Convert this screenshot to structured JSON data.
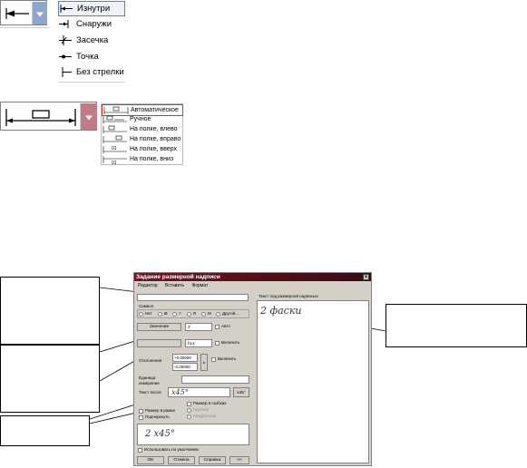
{
  "arrow_combo": {
    "icon": "arrow-inside-icon"
  },
  "arrow_list": {
    "items": [
      {
        "label": "Изнутри",
        "icon": "arrow-inside-icon",
        "selected": true
      },
      {
        "label": "Снаружи",
        "icon": "arrow-outside-icon"
      },
      {
        "label": "Засечка",
        "icon": "tick-mark-icon"
      },
      {
        "label": "Точка",
        "icon": "dot-icon"
      },
      {
        "label": "Без стрелки",
        "icon": "no-arrow-icon"
      }
    ]
  },
  "placement_list": {
    "items": [
      {
        "label": "Автоматическое",
        "selected": true
      },
      {
        "label": "Ручное"
      },
      {
        "label": "На полке, влево"
      },
      {
        "label": "На полке, вправо"
      },
      {
        "label": "На полке, вверх"
      },
      {
        "label": "На полке, вниз"
      }
    ],
    "icon_labels": {
      "up": "01",
      "down": "01"
    }
  },
  "dialog": {
    "title": "Задание размерной надписи",
    "menu": [
      "Редактор",
      "Вставить",
      "Формат"
    ],
    "symbol_label": "Символ",
    "symbol_options": [
      "Нет",
      "Ø",
      "□",
      "R",
      "M",
      "Другой..."
    ],
    "value_button": "Значение",
    "value_field": "2",
    "auto_label": "Авто",
    "tolerance_field": "h14",
    "include_label": "Включить",
    "deviations_label": "Отклонения",
    "deviation_upper": "+0.00000",
    "deviation_lower": "-0.25000",
    "include_label2": "Включить",
    "units_label": "Единица измерения",
    "text_after_label": "Текст после",
    "text_after_value": "x45°",
    "text_after_button": "x45°",
    "in_frame_label": "Размер в рамке",
    "underline_label": "Подчеркнуть",
    "in_brackets_label": "Размер в скобках",
    "bracket_opt1": "Круглые",
    "bracket_opt2": "Квадратные",
    "preview_text": "2 x45°",
    "right_label": "Текст под размерной надписью",
    "below_text": "2 фаски",
    "use_default_label": "Использовать по умолчанию",
    "buttons": [
      "OK",
      "Отмена",
      "Справка",
      "<<"
    ]
  }
}
